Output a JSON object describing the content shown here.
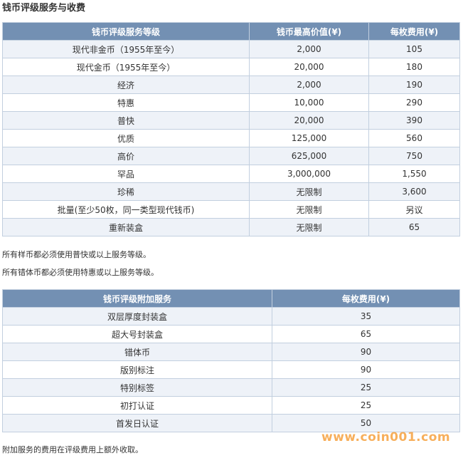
{
  "title": "钱币评级服务与收费",
  "fee_table": {
    "headers": [
      "钱币评级服务等级",
      "钱币最高价值(¥)",
      "每枚费用(¥)"
    ],
    "rows": [
      [
        "现代非金币（1955年至今）",
        "2,000",
        "105"
      ],
      [
        "现代金币（1955年至今）",
        "20,000",
        "180"
      ],
      [
        "经济",
        "2,000",
        "190"
      ],
      [
        "特惠",
        "10,000",
        "290"
      ],
      [
        "普快",
        "20,000",
        "390"
      ],
      [
        "优质",
        "125,000",
        "560"
      ],
      [
        "高价",
        "625,000",
        "750"
      ],
      [
        "罕品",
        "3,000,000",
        "1,550"
      ],
      [
        "珍稀",
        "无限制",
        "3,600"
      ],
      [
        "批量(至少50枚，同一类型现代钱币)",
        "无限制",
        "另议"
      ],
      [
        "重新装盒",
        "无限制",
        "65"
      ]
    ]
  },
  "notes": [
    "所有样币都必须使用普快或以上服务等级。",
    "所有错体币都必须使用特惠或以上服务等级。"
  ],
  "addon_table": {
    "headers": [
      "钱币评级附加服务",
      "每枚费用(¥)"
    ],
    "rows": [
      [
        "双层厚度封装盒",
        "35"
      ],
      [
        "超大号封装盒",
        "65"
      ],
      [
        "错体币",
        "90"
      ],
      [
        "版别标注",
        "90"
      ],
      [
        "特别标签",
        "25"
      ],
      [
        "初打认证",
        "25"
      ],
      [
        "首发日认证",
        "50"
      ]
    ]
  },
  "footer_note": "附加服务的费用在评级费用上额外收取。",
  "watermark": "www.coin001.com"
}
